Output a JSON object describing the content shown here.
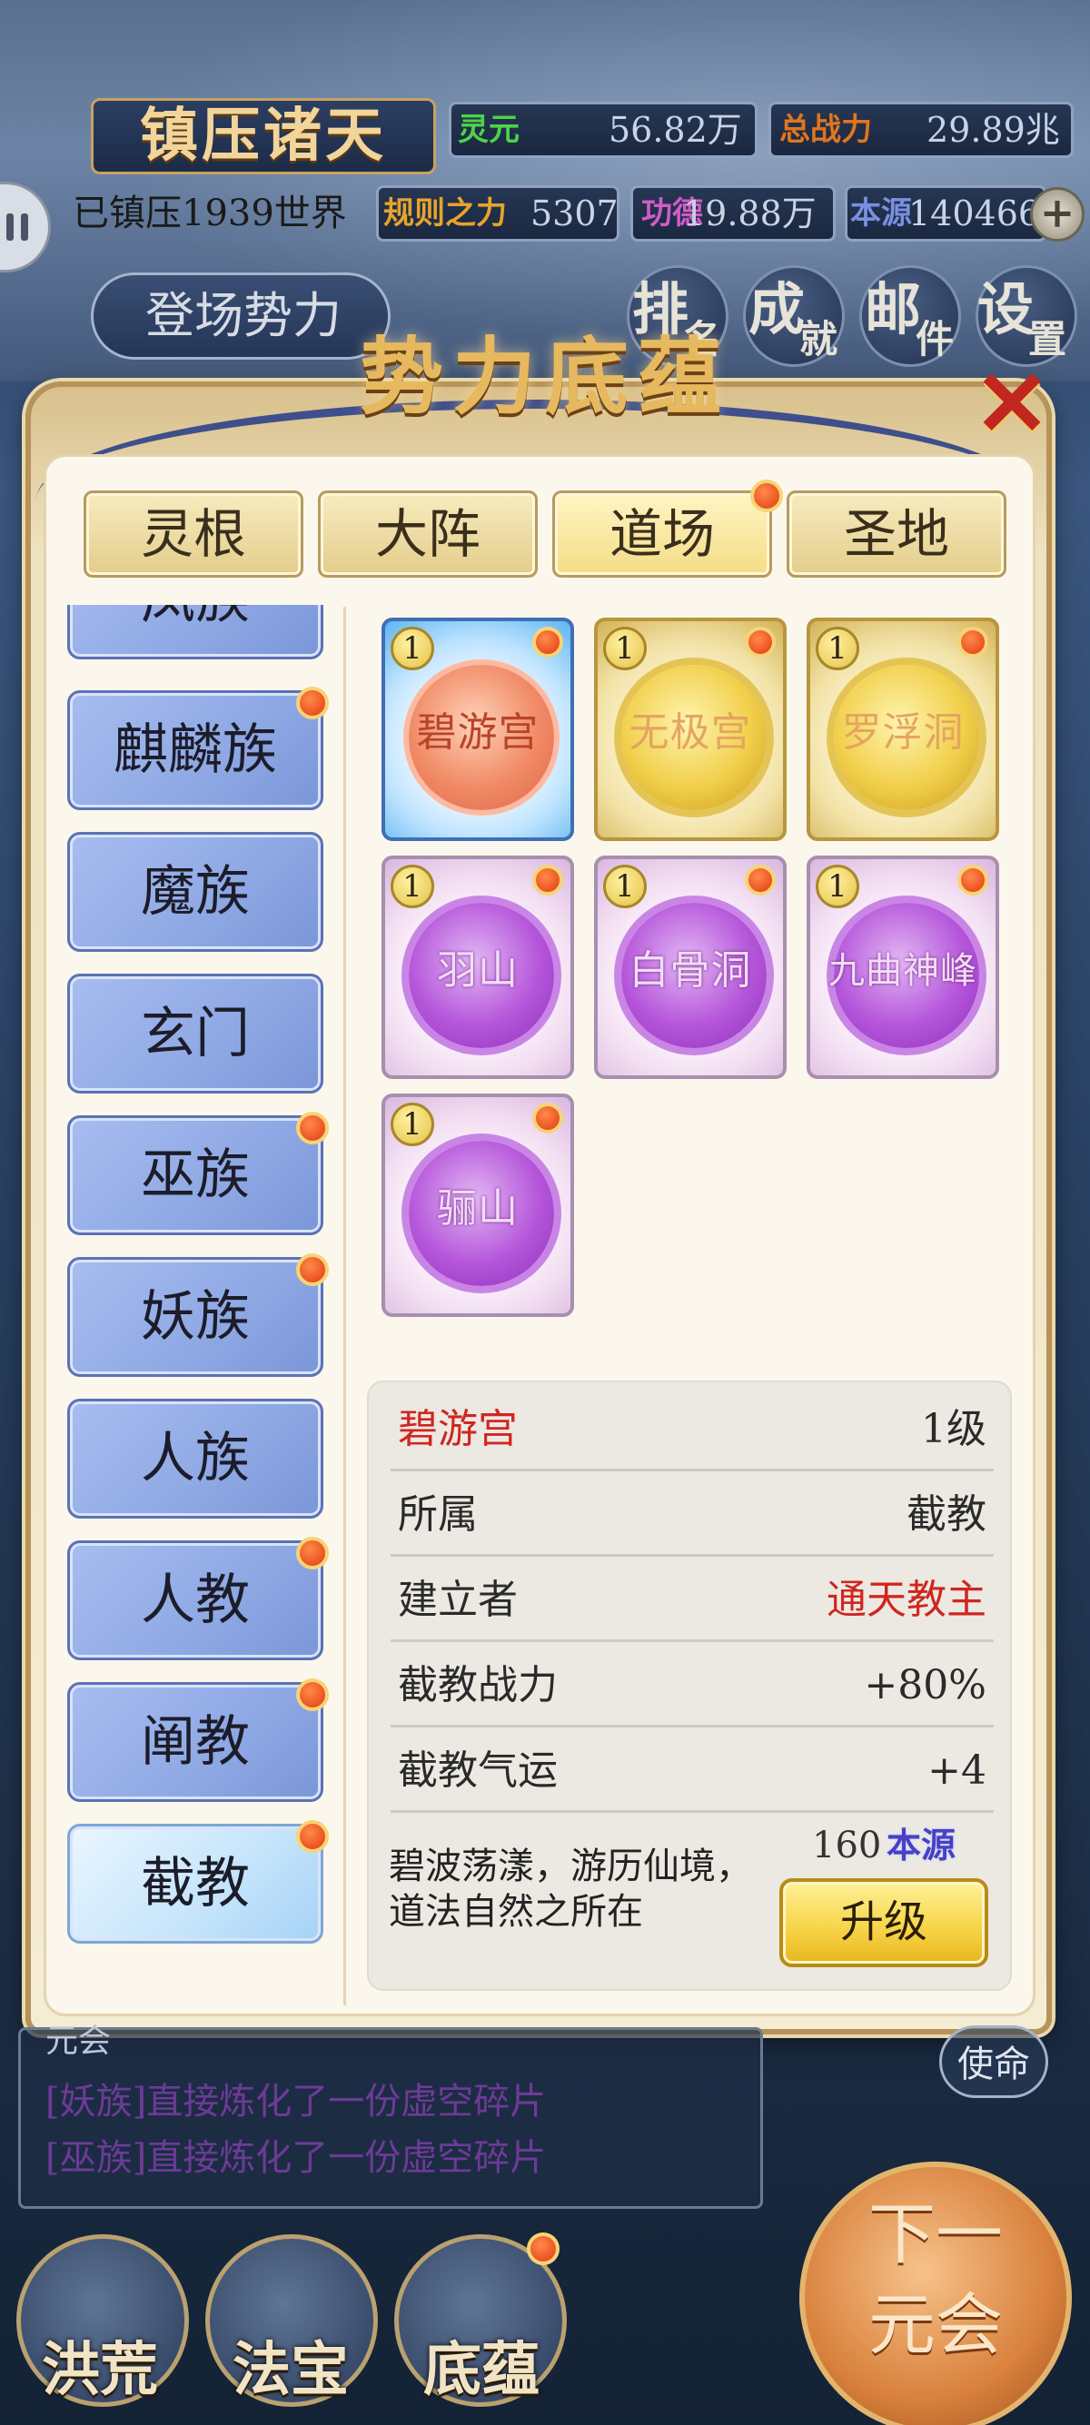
{
  "hud": {
    "game_title": "镇压诸天",
    "world_status": "已镇压1939世界",
    "stats": [
      {
        "label": "灵元",
        "value": "56.82万",
        "color": "#4fd24a"
      },
      {
        "label": "总战力",
        "value": "29.89兆",
        "color": "#e0761e"
      },
      {
        "label": "规则之力",
        "value": "5307",
        "color": "#e7a42a"
      },
      {
        "label": "功德",
        "value": "19.88万",
        "color": "#d05cc7"
      },
      {
        "label": "本源",
        "value": "140466",
        "color": "#7a8fe0"
      }
    ],
    "add_icon": "+",
    "faction_tab": "登场势力",
    "top_buttons": [
      {
        "main": "排",
        "sub": "名"
      },
      {
        "main": "成",
        "sub": "就"
      },
      {
        "main": "邮",
        "sub": "件"
      },
      {
        "main": "设",
        "sub": "置"
      }
    ]
  },
  "panel": {
    "title": "势力底蕴",
    "close_icon": "✕",
    "tabs": [
      {
        "label": "灵根",
        "badge": false
      },
      {
        "label": "大阵",
        "badge": false
      },
      {
        "label": "道场",
        "badge": true,
        "active": true
      },
      {
        "label": "圣地",
        "badge": false
      }
    ],
    "side_list": [
      {
        "label": "凤族",
        "badge": false
      },
      {
        "label": "麒麟族",
        "badge": true
      },
      {
        "label": "魔族",
        "badge": false
      },
      {
        "label": "玄门",
        "badge": false
      },
      {
        "label": "巫族",
        "badge": true
      },
      {
        "label": "妖族",
        "badge": true
      },
      {
        "label": "人族",
        "badge": false
      },
      {
        "label": "人教",
        "badge": true
      },
      {
        "label": "阐教",
        "badge": true
      },
      {
        "label": "截教",
        "badge": true,
        "selected": true
      }
    ],
    "cards": [
      {
        "name": "碧游宫",
        "level": "1",
        "rarity": "blue",
        "badge": true
      },
      {
        "name": "无极宫",
        "level": "1",
        "rarity": "gold",
        "badge": true
      },
      {
        "name": "罗浮洞",
        "level": "1",
        "rarity": "gold",
        "badge": true
      },
      {
        "name": "羽山",
        "level": "1",
        "rarity": "purple",
        "badge": true
      },
      {
        "name": "白骨洞",
        "level": "1",
        "rarity": "purple",
        "badge": true
      },
      {
        "name": "九曲神峰",
        "level": "1",
        "rarity": "purple",
        "badge": true
      },
      {
        "name": "骊山",
        "level": "1",
        "rarity": "purple",
        "badge": true
      }
    ],
    "info": {
      "name": "碧游宫",
      "level": "1级",
      "rows": [
        {
          "key": "所属",
          "value": "截教",
          "highlight": false
        },
        {
          "key": "建立者",
          "value": "通天教主",
          "highlight": true
        },
        {
          "key": "截教战力",
          "value": "+80%",
          "highlight": false
        },
        {
          "key": "截教气运",
          "value": "+4",
          "highlight": false
        }
      ],
      "description_line1": "碧波荡漾，游历仙境，",
      "description_line2": "道法自然之所在",
      "cost_amount": "160",
      "cost_unit": "本源",
      "upgrade_label": "升级"
    }
  },
  "bottom": {
    "log_header": "元会",
    "log_lines": [
      "[妖族]直接炼化了一份虚空碎片",
      "[巫族]直接炼化了一份虚空碎片"
    ],
    "mission_label": "使命",
    "next_line1": "下一",
    "next_line2": "元会",
    "nav": [
      {
        "label": "洪荒",
        "badge": false
      },
      {
        "label": "法宝",
        "badge": false
      },
      {
        "label": "底蕴",
        "badge": true
      }
    ]
  }
}
